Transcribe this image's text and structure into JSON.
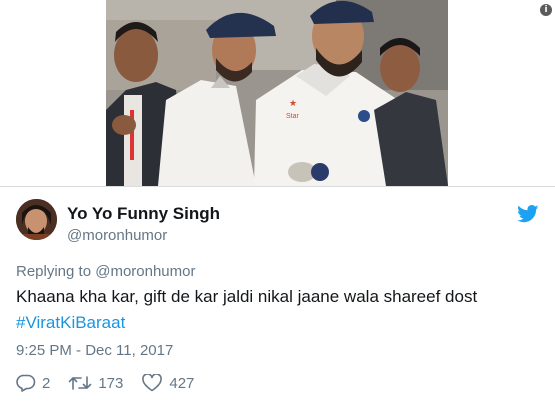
{
  "tweet": {
    "display_name": "Yo Yo Funny Singh",
    "handle": "@moronhumor",
    "replying_prefix": "Replying to",
    "replying_handle": "@moronhumor",
    "text": "Khaana kha kar, gift de kar jaldi nikal jaane wala shareef dost",
    "hashtag": "#ViratKiBaraat",
    "timestamp": "9:25 PM - Dec 11, 2017",
    "reply_count": "2",
    "retweet_count": "173",
    "like_count": "427"
  },
  "icons": {
    "info": "info-icon",
    "twitter": "twitter-bird-icon",
    "reply": "reply-icon",
    "retweet": "retweet-icon",
    "like": "heart-icon"
  },
  "colors": {
    "link": "#1b95e0",
    "muted": "#657786",
    "text": "#14171a"
  }
}
